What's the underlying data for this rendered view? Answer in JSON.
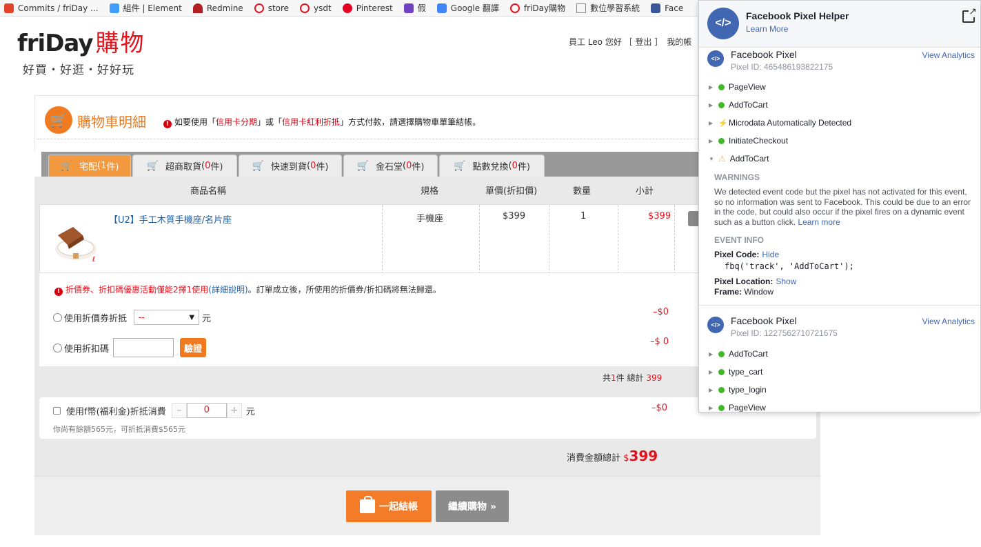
{
  "bookmarks": [
    {
      "label": "Commits / friDay ...",
      "color": "#e24329"
    },
    {
      "label": "組件 | Element",
      "color": "#409eff"
    },
    {
      "label": "Redmine",
      "color": "#b32024"
    },
    {
      "label": "store",
      "color": "#e4141e"
    },
    {
      "label": "ysdt",
      "color": "#e4141e"
    },
    {
      "label": "Pinterest",
      "color": "#e60023"
    },
    {
      "label": "假",
      "color": "#6f42c1"
    },
    {
      "label": "Google 翻譯",
      "color": "#4285f4"
    },
    {
      "label": "friDay購物",
      "color": "#e4141e"
    },
    {
      "label": "數位學習系統",
      "color": "#888888"
    },
    {
      "label": "Face",
      "color": "#3b5998"
    }
  ],
  "site": {
    "logo_text": "friDay",
    "logo_red": "購物",
    "slogan": "好買・好逛・好好玩",
    "greeting": "員工 Leo 您好 ［ 登出 ］　我的帳"
  },
  "cart": {
    "title": "購物車明細",
    "notice_pre": "如要使用「",
    "notice_red1": "信用卡分期",
    "notice_mid": "」或「",
    "notice_red2": "信用卡紅利折抵",
    "notice_post": "」方式付款，請選擇購物車單筆結帳。",
    "tabs": [
      {
        "label": "宅配",
        "count": "1",
        "pre": "(",
        "post": "件)"
      },
      {
        "label": "超商取貨",
        "count": "0",
        "pre": "(",
        "post": "件)"
      },
      {
        "label": "快速到貨",
        "count": "0",
        "pre": "(",
        "post": "件)"
      },
      {
        "label": "金石堂",
        "count": "0",
        "pre": "(",
        "post": "件)"
      },
      {
        "label": "點數兌換",
        "count": "0",
        "pre": "(",
        "post": "件)"
      }
    ],
    "columns": [
      "商品名稱",
      "規格",
      "單價(折扣價)",
      "數量",
      "小計"
    ],
    "item": {
      "name": "【U2】手工木質手機座/名片座",
      "spec": "手機座",
      "price": "$399",
      "qty": "1",
      "subtotal": "$399"
    },
    "coupon_note_red": "折價券、折扣碼優惠活動僅能2擇1使用",
    "coupon_note_link": "(詳細說明)",
    "coupon_note_rest": "。訂單成立後，所使用的折價券/折扣碼將無法歸還。",
    "coupon_label": "使用折價券折抵",
    "coupon_select": "--",
    "unit": "元",
    "coupon_amount": "–$0",
    "code_label": "使用折扣碼",
    "code_value": "",
    "verify_label": "驗證",
    "code_amount": "–$ 0",
    "total_pre": "共",
    "total_count": "1",
    "total_mid": "件 總計",
    "total_value": "399",
    "fcoin_label": "使用f幣(福利金)折抵消費",
    "fcoin_minus": "–",
    "fcoin_value": "0",
    "fcoin_plus": "+",
    "fcoin_amount": "–$0",
    "fcoin_sub": "你尚有餘額565元，可折抵消費$565元",
    "grand_label": "消費金額總計",
    "grand_currency": "$",
    "grand_value": "399",
    "checkout_label": "一起結帳",
    "continue_label": "繼續購物 »"
  },
  "pixel_helper": {
    "title": "Facebook Pixel Helper",
    "learn_more": "Learn More",
    "pixels": [
      {
        "name": "Facebook Pixel",
        "id": "Pixel ID: 465486193822175",
        "analytics": "View Analytics",
        "events": [
          "PageView",
          "AddToCart",
          "Microdata Automatically Detected",
          "InitiateCheckout",
          "AddToCart"
        ]
      },
      {
        "name": "Facebook Pixel",
        "id": "Pixel ID: 1227562710721675",
        "analytics": "View Analytics",
        "events": [
          "AddToCart",
          "type_cart",
          "type_login",
          "PageView"
        ]
      }
    ],
    "warnings_heading": "WARNINGS",
    "warning_text": "We detected event code but the pixel has not activated for this event, so no information was sent to Facebook. This could be due to an error in the code, but could also occur if the pixel fires on a dynamic event such as a button click.",
    "warning_link": "Learn more",
    "event_info_heading": "EVENT INFO",
    "pixel_code_label": "Pixel Code:",
    "pixel_code_link": "Hide",
    "pixel_code": "fbq('track', 'AddToCart');",
    "pixel_location_label": "Pixel Location:",
    "pixel_location_link": "Show",
    "frame_label": "Frame:",
    "frame_value": "Window"
  }
}
